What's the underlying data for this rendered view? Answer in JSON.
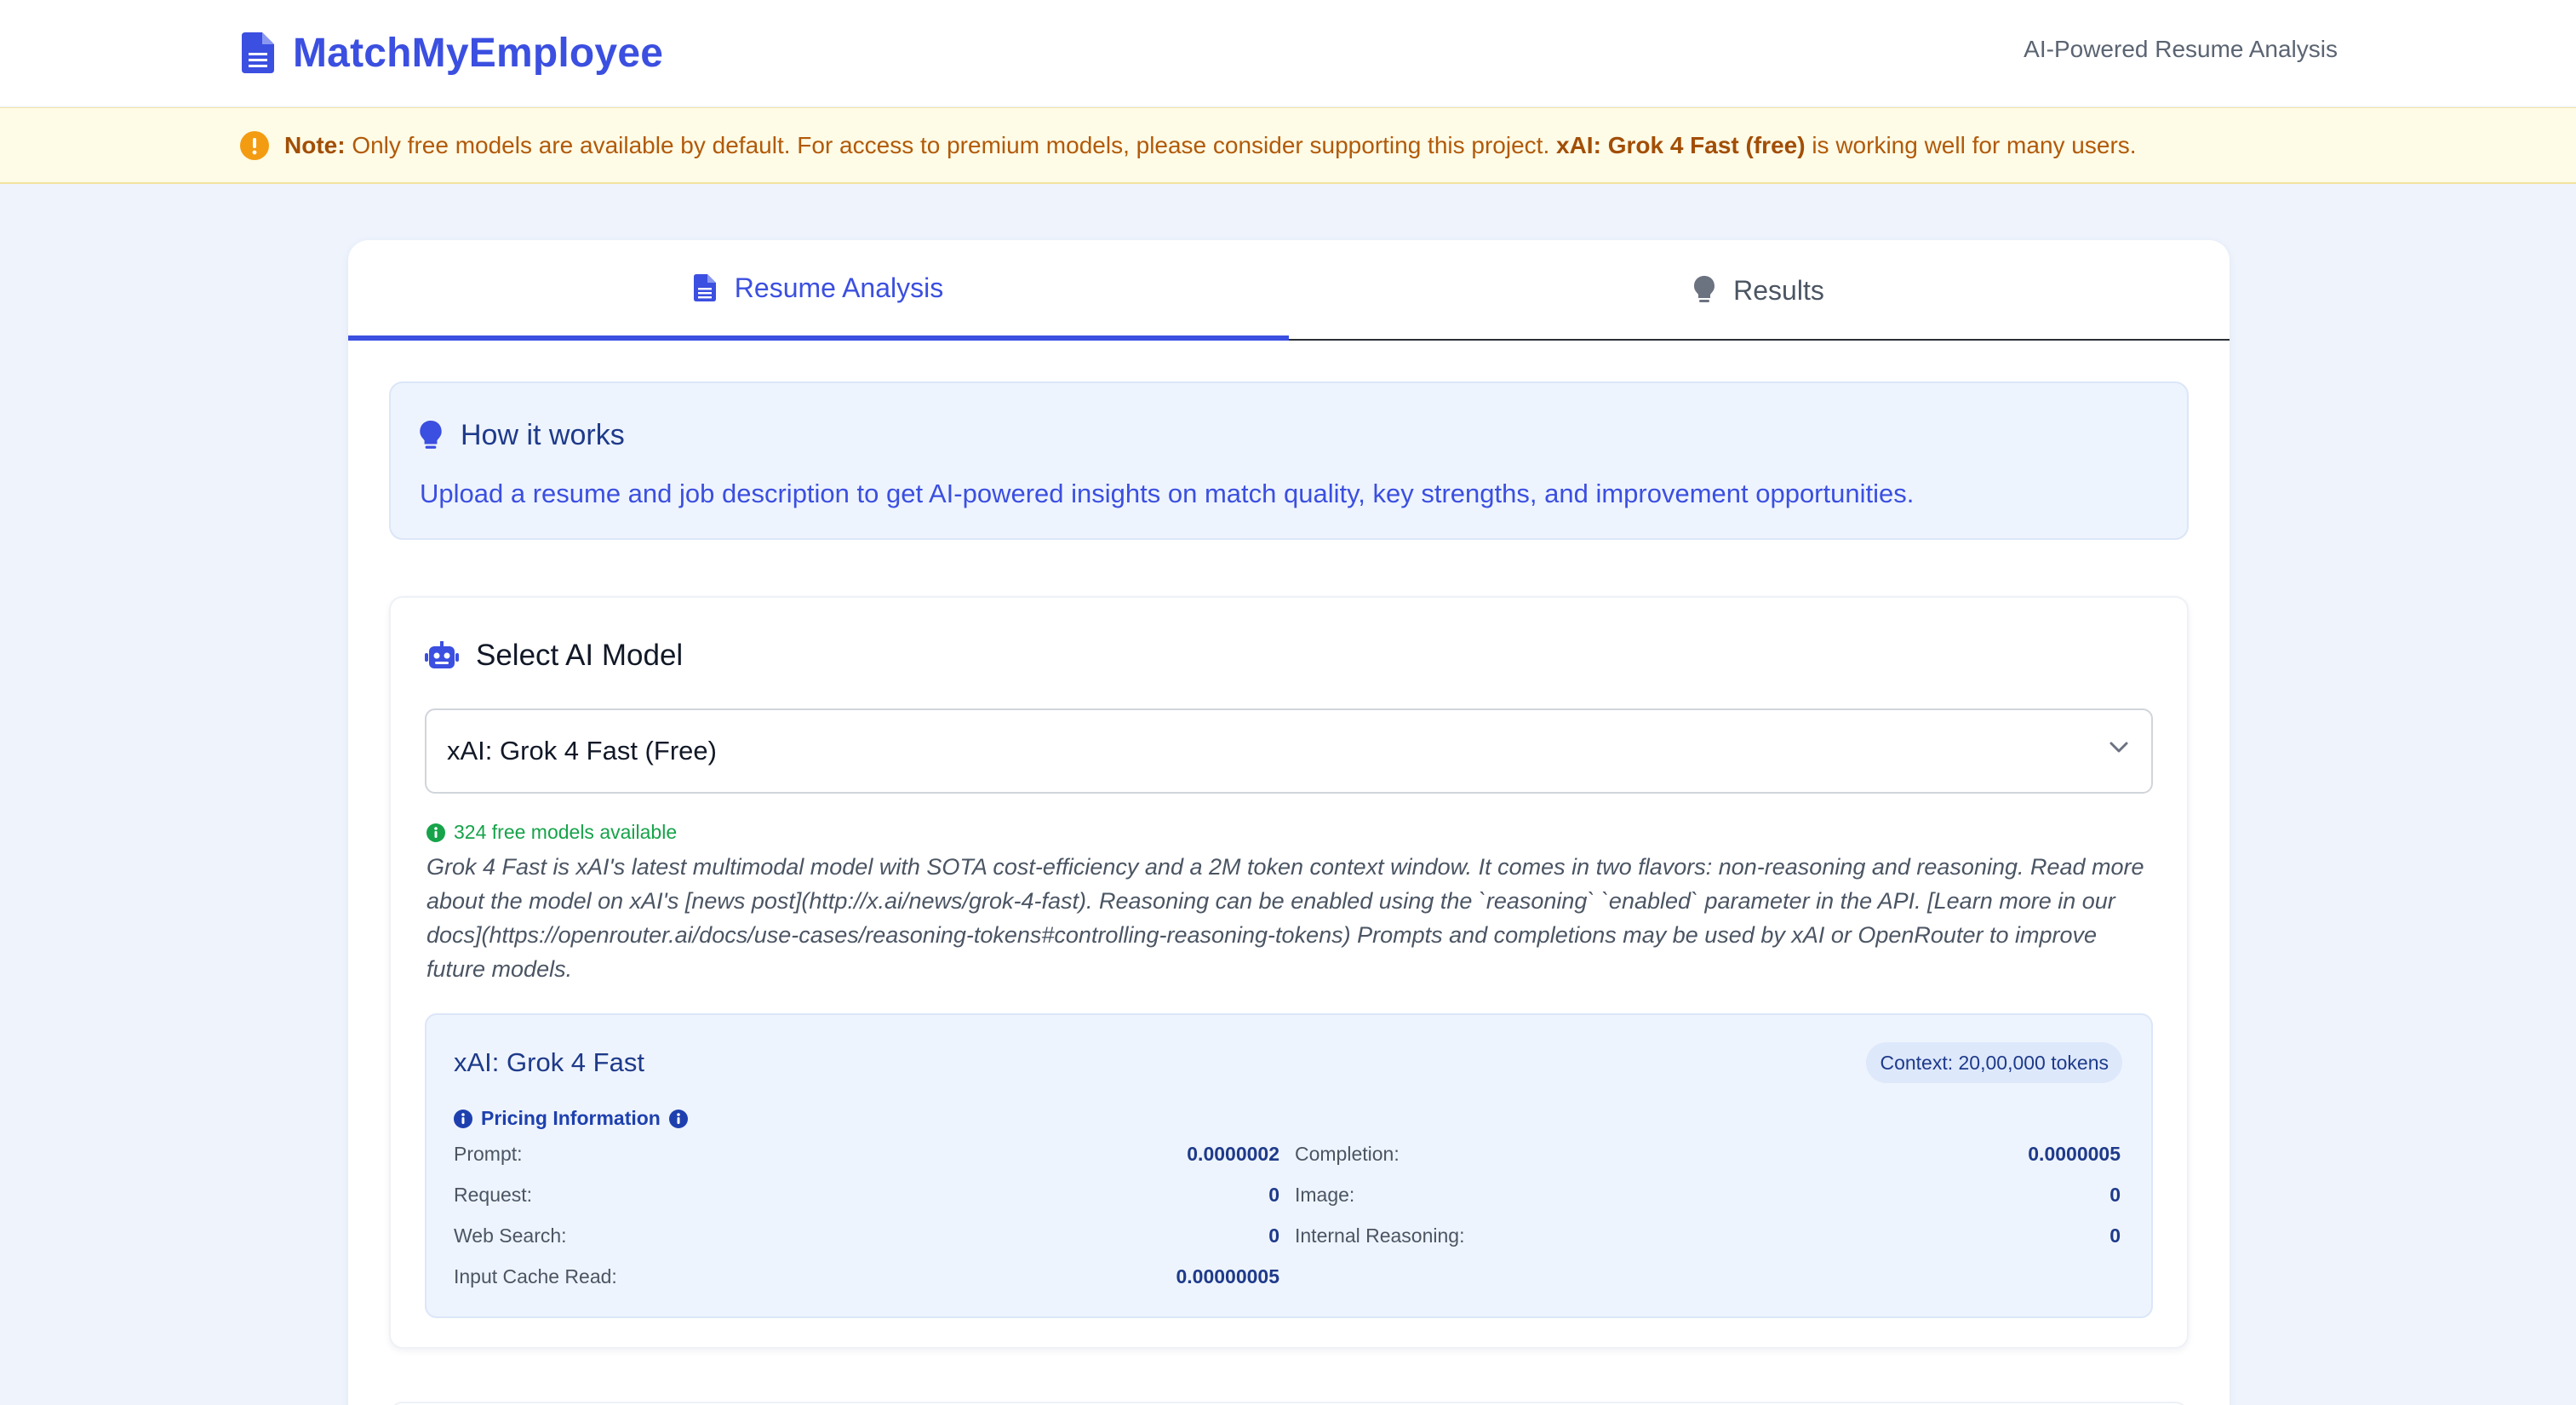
{
  "header": {
    "brand_title": "MatchMyEmployee",
    "tagline": "AI-Powered Resume Analysis"
  },
  "notice": {
    "label": "Note:",
    "text_before": "Only free models are available by default. For access to premium models, please consider supporting this project.",
    "highlight": "xAI: Grok 4 Fast (free)",
    "text_after": "is working well for many users."
  },
  "tabs": [
    {
      "label": "Resume Analysis",
      "icon": "document-icon",
      "active": true
    },
    {
      "label": "Results",
      "icon": "lightbulb-icon",
      "active": false
    }
  ],
  "how_it_works": {
    "title": "How it works",
    "text": "Upload a resume and job description to get AI-powered insights on match quality, key strengths, and improvement opportunities."
  },
  "model_section": {
    "title": "Select AI Model",
    "selected_model": "xAI: Grok 4 Fast (Free)",
    "available_text": "324 free models available",
    "description": "Grok 4 Fast is xAI's latest multimodal model with SOTA cost-efficiency and a 2M token context window. It comes in two flavors: non-reasoning and reasoning. Read more about the model on xAI's [news post](http://x.ai/news/grok-4-fast). Reasoning can be enabled using the `reasoning` `enabled` parameter in the API. [Learn more in our docs](https://openrouter.ai/docs/use-cases/reasoning-tokens#controlling-reasoning-tokens) Prompts and completions may be used by xAI or OpenRouter to improve future models.",
    "detail": {
      "name": "xAI: Grok 4 Fast",
      "context": "Context: 20,00,000 tokens",
      "pricing_title": "Pricing Information",
      "prices": {
        "prompt_label": "Prompt:",
        "prompt_value": "0.0000002",
        "completion_label": "Completion:",
        "completion_value": "0.0000005",
        "request_label": "Request:",
        "request_value": "0",
        "image_label": "Image:",
        "image_value": "0",
        "web_search_label": "Web Search:",
        "web_search_value": "0",
        "internal_reasoning_label": "Internal Reasoning:",
        "internal_reasoning_value": "0",
        "input_cache_read_label": "Input Cache Read:",
        "input_cache_read_value": "0.00000005"
      }
    }
  },
  "colors": {
    "accent": "#3b4fe0",
    "notice_bg": "#fefbe6",
    "notice_text": "#b15a0a",
    "success": "#16a34a",
    "info_bg": "#eef4fd"
  }
}
